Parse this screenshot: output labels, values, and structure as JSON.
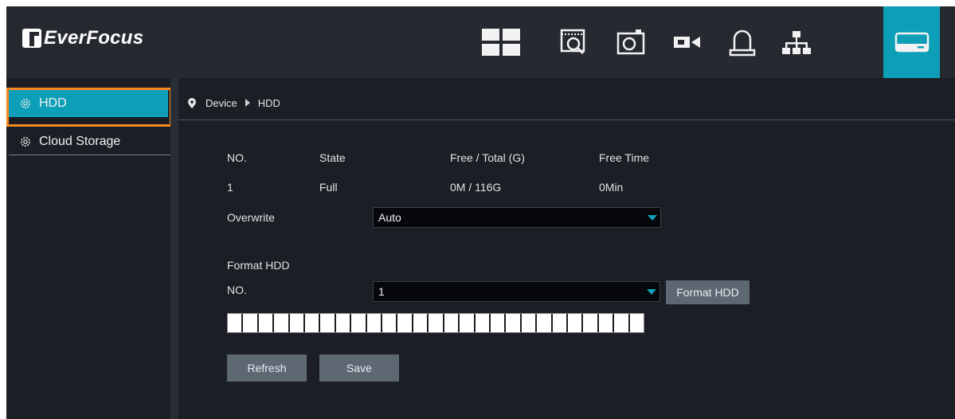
{
  "brand": {
    "name": "EverFocus"
  },
  "topnav": [
    {
      "icon": "live-view-grid-icon",
      "active": false
    },
    {
      "icon": "playback-search-icon",
      "active": false
    },
    {
      "icon": "snapshot-camera-icon",
      "active": false
    },
    {
      "icon": "video-camera-icon",
      "active": false
    },
    {
      "icon": "alarm-bell-icon",
      "active": false
    },
    {
      "icon": "network-icon",
      "active": false
    },
    {
      "icon": "device-hdd-icon",
      "active": true
    }
  ],
  "sidebar": {
    "items": [
      {
        "label": "HDD",
        "icon": "gear-icon",
        "active": true
      },
      {
        "label": "Cloud Storage",
        "icon": "gear-icon",
        "active": false
      }
    ]
  },
  "breadcrumb": {
    "icon": "location-pin-icon",
    "items": [
      "Device",
      "HDD"
    ]
  },
  "hdd_table": {
    "headers": [
      "NO.",
      "State",
      "Free / Total (G)",
      "Free Time"
    ],
    "rows": [
      [
        "1",
        "Full",
        "0M / 116G",
        "0Min"
      ]
    ]
  },
  "overwrite": {
    "label": "Overwrite",
    "value": "Auto"
  },
  "format": {
    "section_label": "Format HDD",
    "no_label": "NO.",
    "no_value": "1",
    "button_label": "Format HDD",
    "progress": 1.0
  },
  "buttons": {
    "refresh_label": "Refresh",
    "save_label": "Save"
  },
  "colors": {
    "accent": "#0e9fb8",
    "highlight": "#f68a1f",
    "background": "#1b1e25",
    "topbar": "#262a30",
    "button": "#5d6873"
  }
}
